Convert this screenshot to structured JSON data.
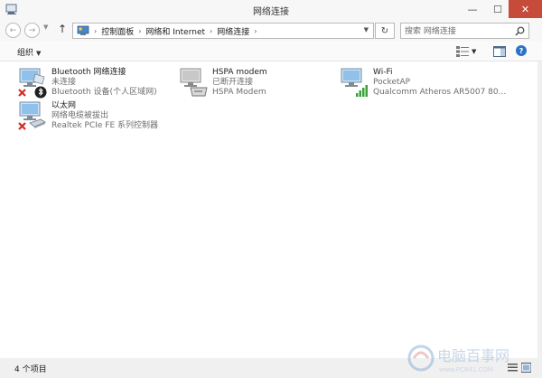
{
  "window": {
    "title": "网络连接",
    "close_glyph": "✕",
    "minimize_glyph": "—",
    "maximize_glyph": "☐"
  },
  "address": {
    "breadcrumbs": [
      "控制面板",
      "网络和 Internet",
      "网络连接"
    ],
    "search_placeholder": "搜索 网络连接"
  },
  "toolbar": {
    "organize_label": "组织"
  },
  "connections": [
    {
      "name": "Bluetooth 网络连接",
      "status": "未连接",
      "device": "Bluetooth 设备(个人区域网)",
      "icon": "bluetooth-network-icon",
      "state": "disconnected"
    },
    {
      "name": "HSPA modem",
      "status": "已断开连接",
      "device": "HSPA Modem",
      "icon": "modem-icon",
      "state": "disconnected"
    },
    {
      "name": "Wi-Fi",
      "status": "PocketAP",
      "device": "Qualcomm Atheros AR5007 80...",
      "icon": "wifi-network-icon",
      "state": "connected"
    },
    {
      "name": "以太网",
      "status": "网络电缆被拔出",
      "device": "Realtek PCIe FE 系列控制器",
      "icon": "ethernet-network-icon",
      "state": "cable-unplugged"
    }
  ],
  "status": {
    "item_count": "4 个项目"
  },
  "colors": {
    "accent": "#2a73c8",
    "close_button": "#c74b3a",
    "error_x": "#d42a20",
    "signal_green": "#3aa13a"
  },
  "watermark": {
    "text": "电脑百事网",
    "url": "www.PC841.COM"
  }
}
